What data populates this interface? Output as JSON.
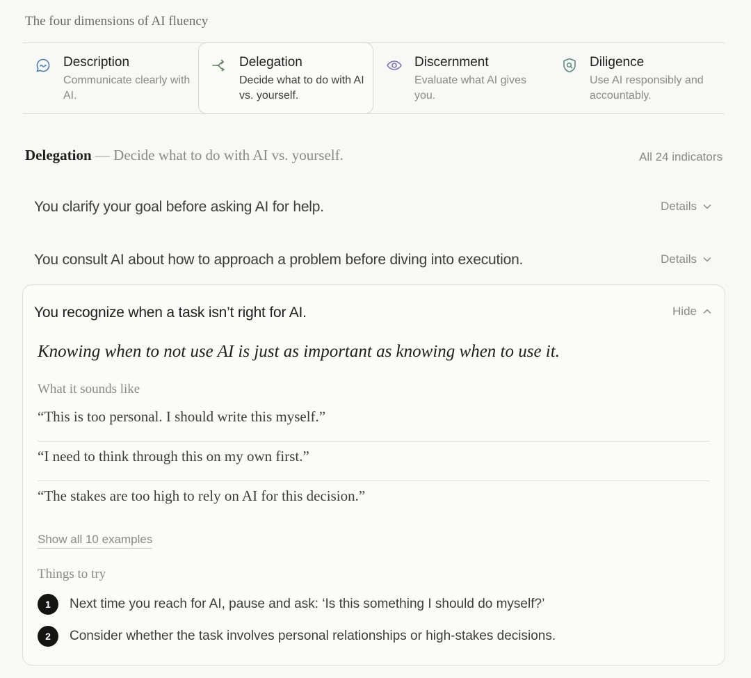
{
  "page_heading": "The four dimensions of AI fluency",
  "tabs": [
    {
      "title": "Description",
      "desc": "Communicate clearly with AI.",
      "icon": "chat-bubble-icon",
      "active": false
    },
    {
      "title": "Delegation",
      "desc": "Decide what to do with AI vs. yourself.",
      "icon": "branch-arrow-icon",
      "active": true
    },
    {
      "title": "Discernment",
      "desc": "Evaluate what AI gives you.",
      "icon": "eye-icon",
      "active": false
    },
    {
      "title": "Diligence",
      "desc": "Use AI responsibly and accountably.",
      "icon": "shield-icon",
      "active": false
    }
  ],
  "section": {
    "title": "Delegation",
    "separator": "—",
    "subtitle": "Decide what to do with AI vs. yourself.",
    "all_indicators": "All 24 indicators"
  },
  "indicators": [
    {
      "text": "You clarify your goal before asking AI for help.",
      "toggle": "Details"
    },
    {
      "text": "You consult AI about how to approach a problem before diving into execution.",
      "toggle": "Details"
    }
  ],
  "expanded": {
    "title": "You recognize when a task isn’t right for AI.",
    "toggle": "Hide",
    "quote": "Knowing when to not use AI is just as important as knowing when to use it.",
    "sounds_like_label": "What it sounds like",
    "examples": [
      "“This is too personal. I should write this myself.”",
      "“I need to think through this on my own first.”",
      "“The stakes are too high to rely on AI for this decision.”"
    ],
    "show_all": "Show all 10 examples",
    "things_label": "Things to try",
    "things": [
      {
        "num": "1",
        "text": "Next time you reach for AI, pause and ask: ‘Is this something I should do myself?’"
      },
      {
        "num": "2",
        "text": "Consider whether the task involves personal relationships or high-stakes decisions."
      }
    ]
  },
  "colors": {
    "background": "#f8f8f6",
    "icon_blue": "#4a7fb5",
    "icon_green": "#5e7f5a",
    "icon_purple": "#7b74b8",
    "icon_teal": "#5b8a80",
    "badge": "#141413"
  }
}
